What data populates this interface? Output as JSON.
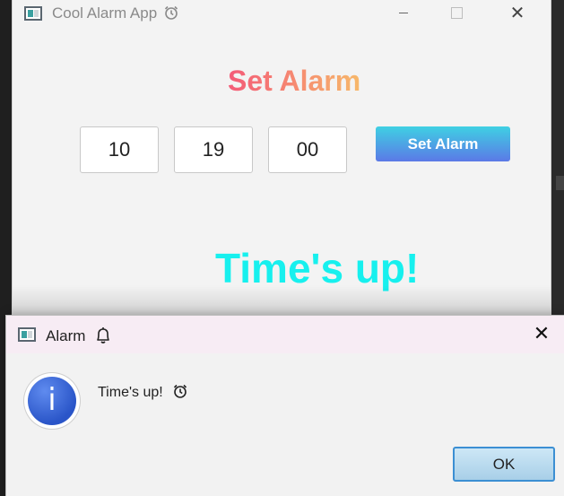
{
  "main_window": {
    "title": "Cool Alarm App",
    "title_icon": "alarm-clock-icon",
    "heading": "Set Alarm",
    "inputs": {
      "hour": "10",
      "minute": "19",
      "second": "00"
    },
    "set_button_label": "Set Alarm",
    "status_message": "Time's up!",
    "colors": {
      "heading_gradient": [
        "#f45b78",
        "#f7b86a"
      ],
      "button_gradient": [
        "#3fd0e3",
        "#5b79e6"
      ],
      "status": "#17f0ee"
    }
  },
  "dialog": {
    "title": "Alarm",
    "title_icon": "bell-icon",
    "message": "Time's up!",
    "message_icon": "alarm-clock-icon",
    "info_glyph": "i",
    "ok_label": "OK"
  }
}
